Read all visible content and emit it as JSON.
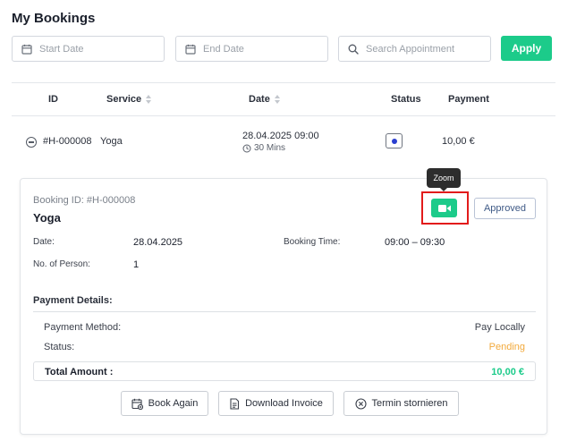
{
  "page": {
    "title": "My Bookings"
  },
  "filters": {
    "start_date_placeholder": "Start Date",
    "end_date_placeholder": "End Date",
    "search_placeholder": "Search Appointment",
    "apply_label": "Apply"
  },
  "table": {
    "headers": {
      "id": "ID",
      "service": "Service",
      "date": "Date",
      "status": "Status",
      "payment": "Payment"
    },
    "rows": [
      {
        "id": "#H-000008",
        "service": "Yoga",
        "date": "28.04.2025 09:00",
        "duration": "30 Mins",
        "payment": "10,00 €"
      }
    ]
  },
  "tooltip": {
    "text": "Zoom"
  },
  "detail": {
    "booking_id": "Booking ID: #H-000008",
    "service": "Yoga",
    "status_badge": "Approved",
    "date_label": "Date:",
    "date_value": "28.04.2025",
    "booking_time_label": "Booking Time:",
    "booking_time_value": "09:00 – 09:30",
    "persons_label": "No. of Person:",
    "persons_value": "1",
    "payment_details_title": "Payment Details:",
    "payment_method_label": "Payment Method:",
    "payment_method_value": "Pay Locally",
    "payment_status_label": "Status:",
    "payment_status_value": "Pending",
    "total_label": "Total Amount :",
    "total_value": "10,00 €",
    "actions": {
      "book_again": "Book Again",
      "download_invoice": "Download Invoice",
      "cancel": "Termin stornieren"
    }
  },
  "icons": {
    "calendar": "calendar-icon",
    "search": "search-icon",
    "sort": "sort-icon",
    "collapse": "minus-circle-icon",
    "video": "video-camera-icon",
    "clock": "clock-icon",
    "invoice": "invoice-icon",
    "cancel": "x-circle-icon"
  },
  "colors": {
    "accent": "#1ccb8a",
    "highlight": "#e21b1b",
    "pending": "#f2a93b",
    "status_dot": "#2b3fd0"
  }
}
